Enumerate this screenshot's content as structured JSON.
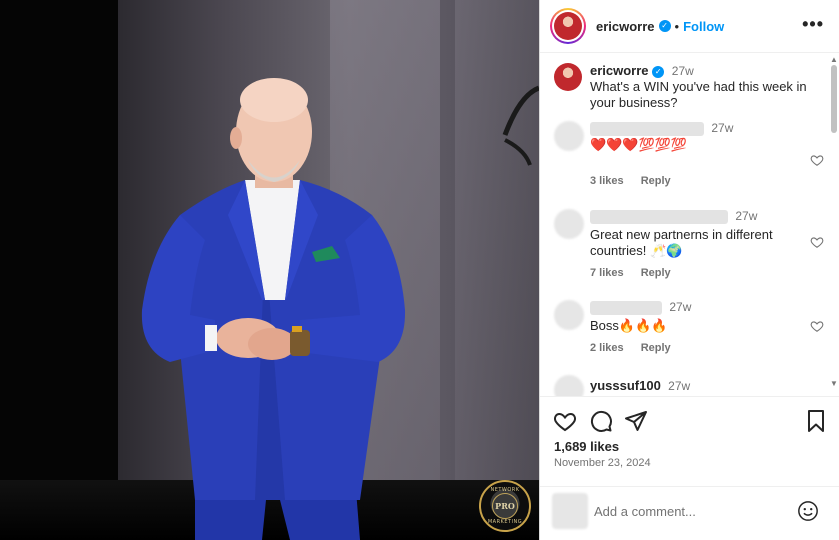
{
  "post": {
    "username": "ericworre",
    "follow_label": "Follow",
    "more_label": "•••",
    "dot": "•"
  },
  "caption": {
    "username": "ericworre",
    "time": "27w",
    "text": "What's a WIN you've had this week in your business?"
  },
  "comments": [
    {
      "time": "27w",
      "text": "❤️❤️❤️💯💯💯",
      "likes": "3 likes",
      "reply": "Reply"
    },
    {
      "time": "27w",
      "text": "Great new partnerns in different countries! 🥂🌍",
      "likes": "7 likes",
      "reply": "Reply"
    },
    {
      "time": "27w",
      "text": "Boss🔥🔥🔥",
      "likes": "2 likes",
      "reply": "Reply"
    },
    {
      "username": "yusssuf100",
      "time": "27w"
    }
  ],
  "stats": {
    "likes": "1,689 likes",
    "date": "November 23, 2024"
  },
  "add_comment": {
    "placeholder": "Add a comment..."
  },
  "badge": {
    "top_text": "NETWORK",
    "bottom_text": "MARKETING",
    "center_text": "PRO"
  },
  "colors": {
    "accent": "#0095f6",
    "suit": "#2a3fb8"
  }
}
